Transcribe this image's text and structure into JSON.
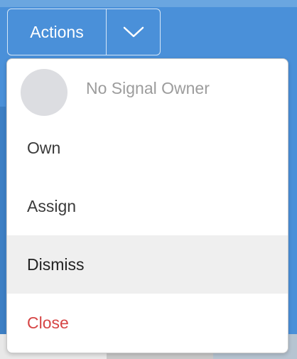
{
  "actions_button": {
    "label": "Actions",
    "toggle_icon": "chevron-down-icon"
  },
  "menu": {
    "owner": {
      "avatar_icon": "avatar-placeholder",
      "label": "No Signal Owner"
    },
    "items": [
      {
        "label": "Own"
      },
      {
        "label": "Assign"
      },
      {
        "label": "Dismiss",
        "highlighted": true
      },
      {
        "label": "Close",
        "color": "#d64545"
      }
    ]
  },
  "colors": {
    "primary": "#4a90d9",
    "danger": "#d64545",
    "hover_bg": "#efefef"
  }
}
